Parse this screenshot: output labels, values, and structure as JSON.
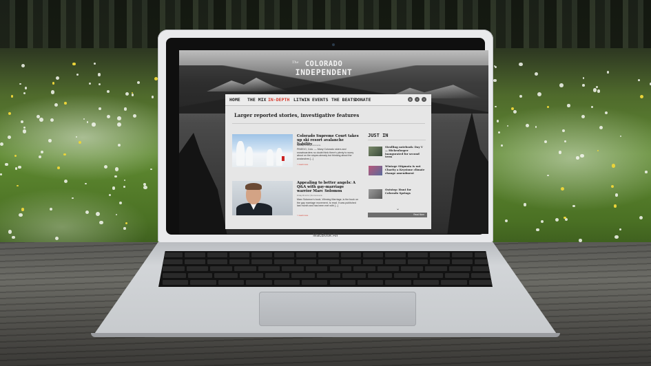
{
  "brand_label": "MacBook Air",
  "site": {
    "logo_the": "The",
    "logo_line1": "COLORADO",
    "logo_line2": "INDEPENDENT",
    "nav": [
      "HOME",
      "THE MIX",
      "IN-DEPTH",
      "LITWIN",
      "EVENTS",
      "THE BEATS",
      "DONATE"
    ],
    "active_nav": "IN-DEPTH",
    "social_icons": [
      "rss-icon",
      "twitter-icon",
      "facebook-icon"
    ],
    "section_headline": "Larger reported stories, investigative features",
    "articles": [
      {
        "title": "Colorado Supreme Court takes up ski resort avalanche liability",
        "meta": "Saturday 07.08 | 5 Comments",
        "excerpt": "PINEDO, Colo. — Many Colorado skiers and snowboarders no doubt think there's plenty to worry about on the slopes already but thinking about the avalanches [...]",
        "more": "> read more"
      },
      {
        "title": "Appealing to better angels: A Q&A with gay-marriage warrior Marc Solomon",
        "meta": "Friday 06.12.14 | No Comments",
        "excerpt": "Marc Solomon's book, Winning Marriage, is the book on the gay marriage movement, to read. It was published last month and has been met with [...]",
        "more": "> read more"
      }
    ],
    "just_in_label": "JUST IN",
    "just_in": [
      "Strolling notebook: Day V — Hickenlooper inaugurated for second term",
      "Wintage Stigmata is not Charity a Keystone climate change amendment",
      "Outstep: Hunt for Colorado Springs"
    ],
    "read_more_button": "Read More",
    "colors": {
      "accent": "#d63a2d",
      "page_background": "#e6e6e6",
      "read_more_bar": "#6d6d6d"
    }
  }
}
